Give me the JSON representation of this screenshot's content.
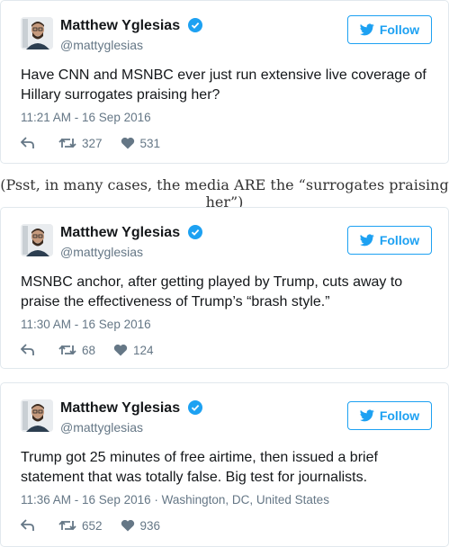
{
  "tweets": [
    {
      "display_name": "Matthew Yglesias",
      "handle": "@mattyglesias",
      "follow_label": "Follow",
      "text_lines": [
        "Have CNN and MSNBC ever just run extensive live coverage of",
        "Hillary surrogates praising her?"
      ],
      "timestamp": "11:21 AM - 16 Sep 2016",
      "retweets": "327",
      "likes": "531"
    },
    {
      "display_name": "Matthew Yglesias",
      "handle": "@mattyglesias",
      "follow_label": "Follow",
      "text_lines": [
        "MSNBC anchor, after getting played by Trump, cuts away to",
        "praise the effectiveness of Trump’s “brash style.”"
      ],
      "timestamp": "11:30 AM - 16 Sep 2016",
      "retweets": "68",
      "likes": "124"
    },
    {
      "display_name": "Matthew Yglesias",
      "handle": "@mattyglesias",
      "follow_label": "Follow",
      "text_lines": [
        "Trump got 25 minutes of free airtime, then issued a brief",
        "statement that was totally false. Big test for journalists."
      ],
      "timestamp": "11:36 AM - 16 Sep 2016 · Washington, DC, United States",
      "retweets": "652",
      "likes": "936"
    }
  ],
  "caption": "(Psst, in many cases, the media ARE the “surrogates praising her”)",
  "colors": {
    "accent": "#1da1f2",
    "muted": "#657786",
    "border": "#e1e8ed"
  }
}
